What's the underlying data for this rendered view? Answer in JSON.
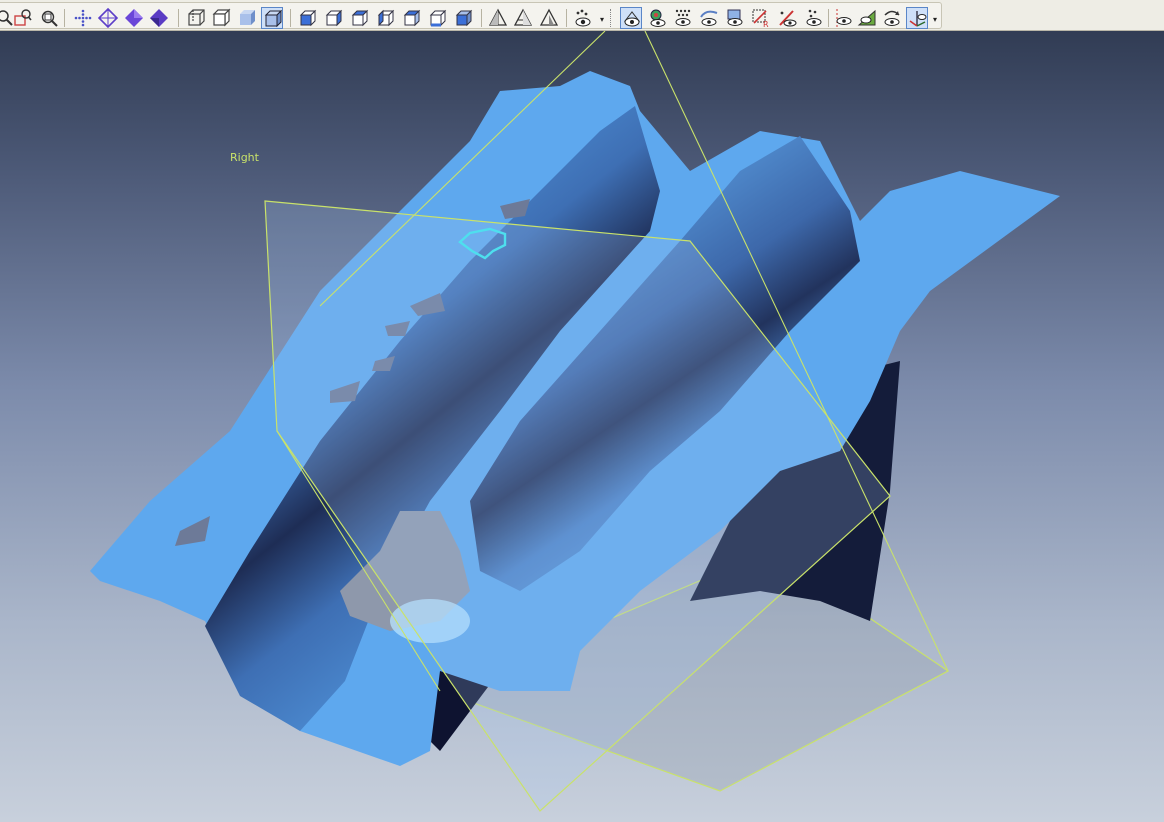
{
  "toolbar": {
    "groups": [
      [
        "zoom-in-icon",
        "zoom-rect-icon",
        "zoom-fit-icon"
      ],
      [
        "pan-icon",
        "rotate-icon",
        "view-center-icon",
        "view-align-icon"
      ],
      [
        "wireframe-icon",
        "hidden-line-icon",
        "shaded-icon",
        "shaded-edges-icon"
      ],
      [
        "view-front-icon",
        "view-back-icon",
        "view-left-icon",
        "view-right-icon",
        "view-top-icon",
        "view-bottom-icon"
      ],
      [
        "clip-plane-icon",
        "section-icon",
        "mirror-icon"
      ],
      [
        "visibility-icon"
      ],
      [
        "show-all-icon",
        "show-mesh-icon",
        "show-points-icon",
        "show-curves-icon",
        "show-surfaces-icon",
        "show-reference-icon",
        "show-features-icon",
        "show-dimensions-icon",
        "show-planes-icon",
        "show-sections-icon",
        "show-normals-icon",
        "show-coords-icon"
      ]
    ]
  },
  "viewport": {
    "plane_label": "Right",
    "background_top": "#313c54",
    "background_bottom": "#c8d0dc",
    "mesh_color": "#5aa7ee",
    "plane_edge_color": "#c9e26a",
    "selection_color": "#35e6ee"
  }
}
